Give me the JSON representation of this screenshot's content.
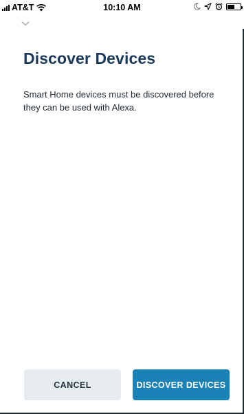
{
  "status_bar": {
    "carrier": "AT&T",
    "time": "10:10 AM",
    "battery_level": 0.55,
    "icons": [
      "signal-icon",
      "wifi-icon",
      "moon-icon",
      "location-icon",
      "alarm-icon",
      "battery-icon"
    ]
  },
  "header": {
    "collapse_icon": "chevron-down-icon"
  },
  "main": {
    "title": "Discover Devices",
    "description": "Smart Home devices must be discovered before they can be used with Alexa."
  },
  "actions": {
    "cancel_label": "CANCEL",
    "discover_label": "DISCOVER DEVICES"
  },
  "colors": {
    "title": "#1b3a5b",
    "primary_button": "#1b82b8",
    "secondary_button": "#e6ecf0"
  }
}
